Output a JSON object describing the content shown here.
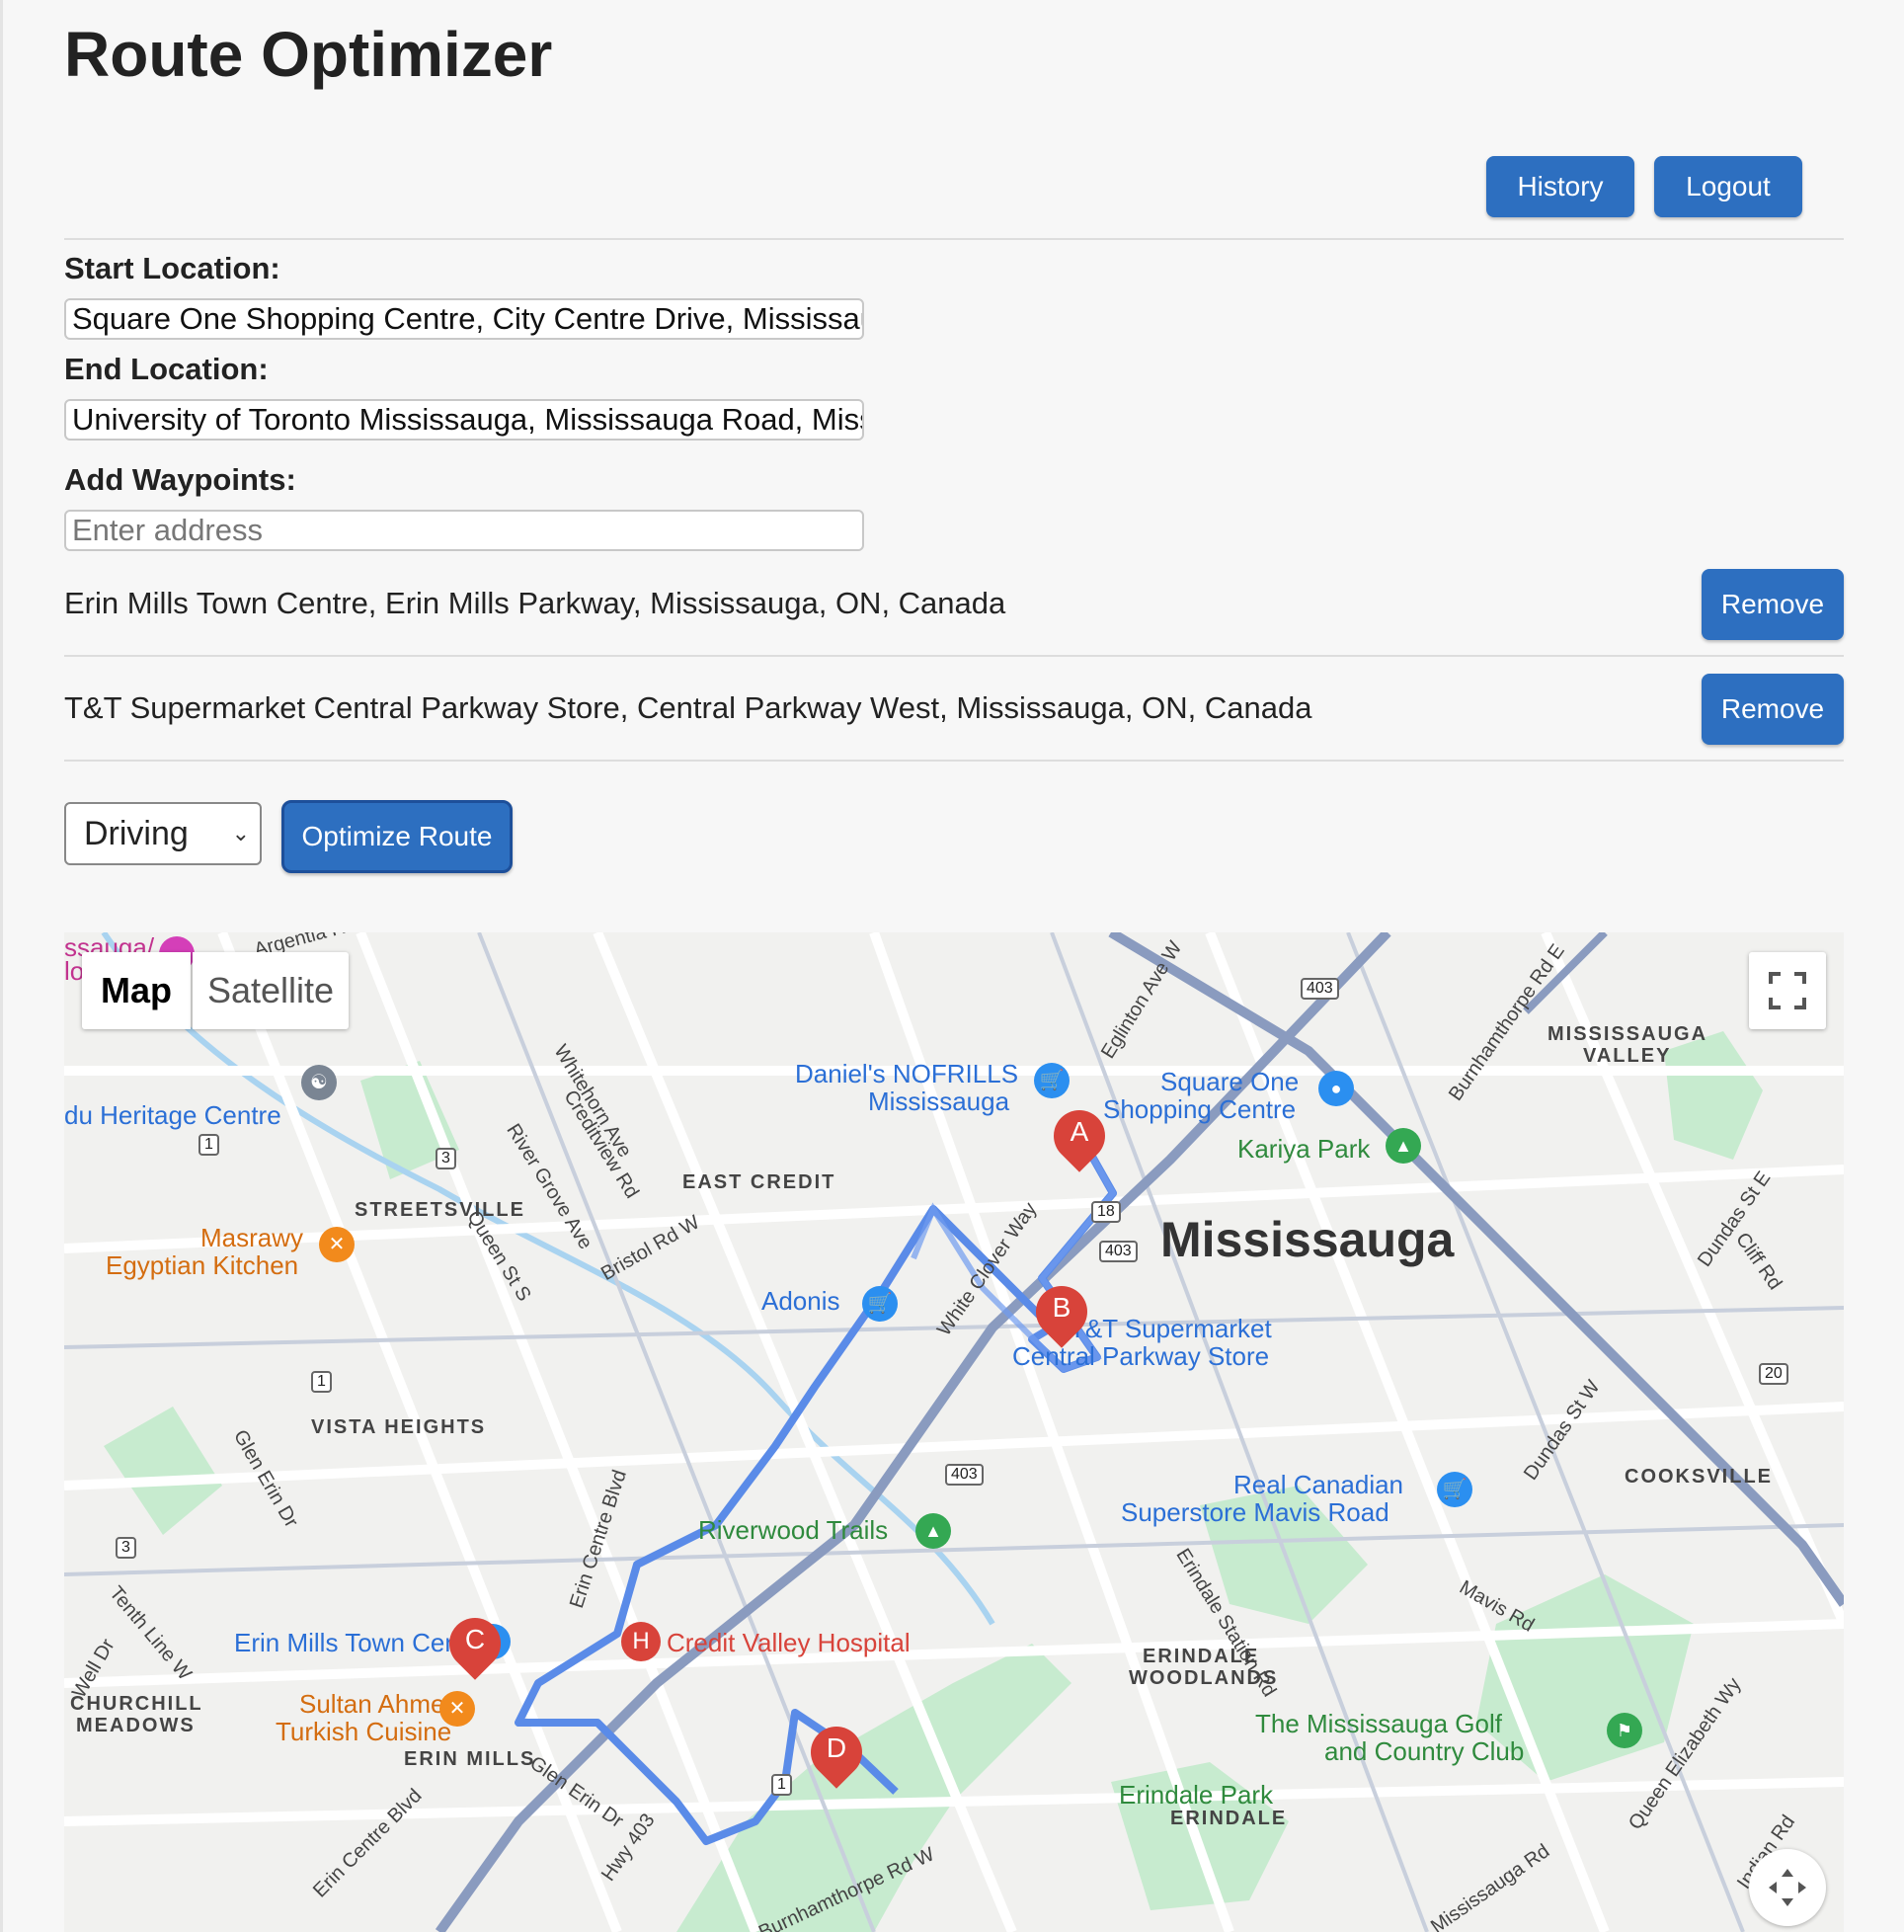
{
  "header": {
    "title": "Route Optimizer",
    "history_label": "History",
    "logout_label": "Logout"
  },
  "form": {
    "start_label": "Start Location:",
    "start_value": "Square One Shopping Centre, City Centre Drive, Mississauga, ON, Canada",
    "end_label": "End Location:",
    "end_value": "University of Toronto Mississauga, Mississauga Road, Mississauga, ON, Canada",
    "waypoints_label": "Add Waypoints:",
    "waypoint_placeholder": "Enter address"
  },
  "waypoints": [
    {
      "address": "Erin Mills Town Centre, Erin Mills Parkway, Mississauga, ON, Canada",
      "remove_label": "Remove"
    },
    {
      "address": "T&T Supermarket Central Parkway Store, Central Parkway West, Mississauga, ON, Canada",
      "remove_label": "Remove"
    }
  ],
  "controls": {
    "mode": "Driving",
    "optimize_label": "Optimize Route"
  },
  "map": {
    "type_map": "Map",
    "type_satellite": "Satellite",
    "city": "Mississauga",
    "markers": [
      "A",
      "B",
      "C",
      "D",
      "H"
    ],
    "neighbourhoods": [
      "STREETSVILLE",
      "EAST CREDIT",
      "VISTA HEIGHTS",
      "MISSISSAUGA",
      "VALLEY",
      "COOKSVILLE",
      "ERINDALE",
      "WOODLANDS",
      "CHURCHILL",
      "MEADOWS",
      "ERIN MILLS",
      "ERINDALE"
    ],
    "roads": [
      "Whitehorn Ave",
      "Creditview Rd",
      "River Grove Ave",
      "Bristol Rd W",
      "Queen St S",
      "Glen Erin Dr",
      "Eglinton Ave W",
      "Burnhamthorpe Rd E",
      "White Clover Way",
      "Dundas St E",
      "Cliff Rd",
      "Dundas St W",
      "Mavis Rd",
      "Erindale Station Rd",
      "Queen Elizabeth Wy",
      "Mississauga Rd",
      "Indian Rd",
      "Erin Centre Blvd",
      "Tenth Line W",
      "Hwy 403",
      "Glen Erin Dr",
      "Erin Centre Blvd",
      "Burnhamthorpe Rd W",
      "Argentia Rd",
      "Well Dr"
    ],
    "highway_shields": [
      "403",
      "403",
      "403",
      "18",
      "1",
      "1",
      "3",
      "3",
      "1",
      "20"
    ],
    "pois": [
      "Daniel's NOFRILLS",
      "Mississauga",
      "Square One",
      "Shopping Centre",
      "Kariya Park",
      "T&T Supermarket",
      "Central Parkway Store",
      "Adonis",
      "Masrawy",
      "Egyptian Kitchen",
      "du Heritage Centre",
      "Riverwood Trails",
      "Real Canadian",
      "Superstore Mavis Road",
      "Erin Mills Town Centre",
      "Credit Valley Hospital",
      "Sultan Ahmet",
      "Turkish Cuisine",
      "The Mississauga Golf",
      "and Country Club",
      "Erindale Park",
      "ssauga/",
      "lo"
    ]
  },
  "colors": {
    "button": "#2d6fc0",
    "route": "#5a8be8",
    "marker": "#d8433a",
    "park": "#c7ebcf",
    "water": "#a9d3f0"
  }
}
